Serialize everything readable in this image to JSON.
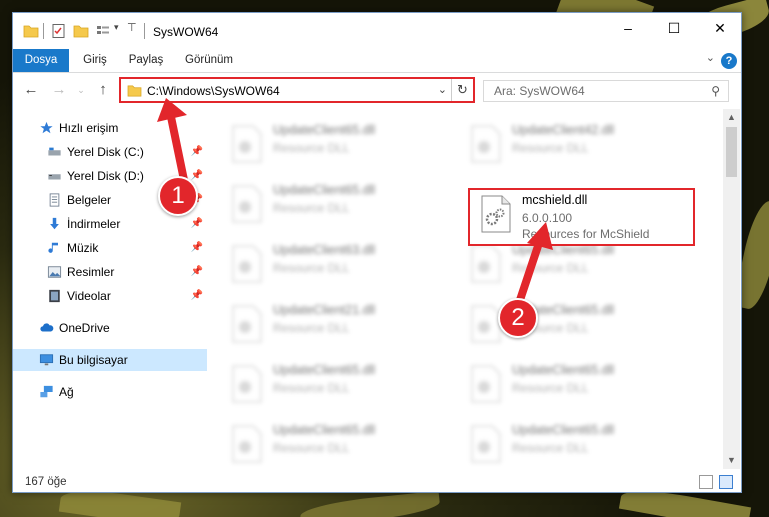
{
  "window": {
    "title": "SysWOW64",
    "controls": {
      "minimize": "–",
      "maximize": "☐",
      "close": "✕"
    }
  },
  "ribbon": {
    "tabs": [
      "Dosya",
      "Giriş",
      "Paylaş",
      "Görünüm"
    ],
    "help": "?"
  },
  "address_bar": {
    "path": "C:\\Windows\\SysWOW64",
    "search_placeholder": "Ara: SysWOW64"
  },
  "nav_pane": {
    "items": [
      {
        "label": "Hızlı erişim",
        "icon": "star-icon",
        "pinned": false
      },
      {
        "label": "Yerel Disk (C:)",
        "icon": "drive-icon",
        "pinned": true
      },
      {
        "label": "Yerel Disk (D:)",
        "icon": "drive-icon",
        "pinned": true
      },
      {
        "label": "Belgeler",
        "icon": "documents-icon",
        "pinned": true
      },
      {
        "label": "İndirmeler",
        "icon": "download-icon",
        "pinned": true
      },
      {
        "label": "Müzik",
        "icon": "music-icon",
        "pinned": true
      },
      {
        "label": "Resimler",
        "icon": "pictures-icon",
        "pinned": true
      },
      {
        "label": "Videolar",
        "icon": "video-icon",
        "pinned": true
      },
      {
        "label": "OneDrive",
        "icon": "cloud-icon",
        "pinned": false
      },
      {
        "label": "Bu bilgisayar",
        "icon": "computer-icon",
        "pinned": false,
        "selected": true
      },
      {
        "label": "Ağ",
        "icon": "network-icon",
        "pinned": false
      }
    ]
  },
  "files": {
    "left_column": [
      {
        "name": "UpdateClient65.dll",
        "desc": "Resource DLL"
      },
      {
        "name": "UpdateClient65.dll",
        "desc": "Resource DLL"
      },
      {
        "name": "UpdateClient63.dll",
        "desc": "Resource DLL"
      },
      {
        "name": "UpdateClient21.dll",
        "desc": "Resource DLL"
      },
      {
        "name": "UpdateClient65.dll",
        "desc": "Resource DLL"
      },
      {
        "name": "UpdateClient65.dll",
        "desc": "Resource DLL"
      }
    ],
    "right_column": [
      {
        "name": "UpdateClient42.dll",
        "desc": "Resource DLL"
      },
      {
        "name": "UpdateClient65.dll",
        "desc": "Resource DLL"
      },
      {
        "name": "UpdateClient65.dll",
        "desc": "Resource DLL"
      },
      {
        "name": "UpdateClient65.dll",
        "desc": "Resource DLL"
      },
      {
        "name": "UpdateClient65.dll",
        "desc": "Resource DLL"
      }
    ],
    "highlighted": {
      "name": "mcshield.dll",
      "version": "6.0.0.100",
      "desc": "Resources for McShield"
    }
  },
  "status": {
    "count": "167 öğe"
  },
  "callouts": {
    "one": "1",
    "two": "2"
  },
  "colors": {
    "accent": "#1979ca",
    "highlight": "#e2262b"
  }
}
